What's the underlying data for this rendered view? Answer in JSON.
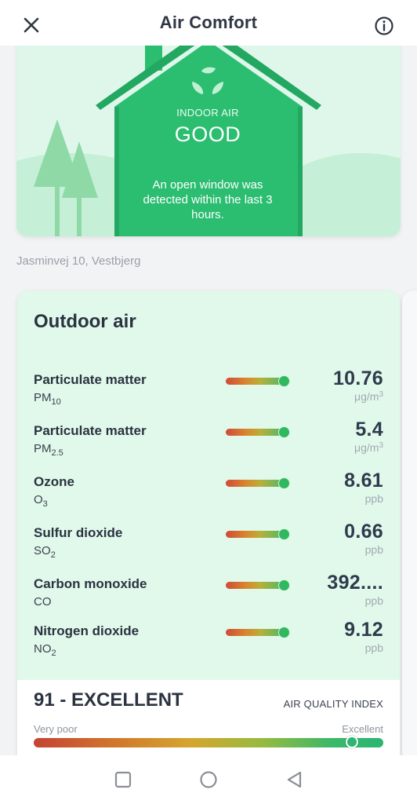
{
  "header": {
    "title": "Air Comfort"
  },
  "icons": {
    "close": "close-icon",
    "info": "info-icon",
    "leaves": "leaves-icon",
    "nav_recents": "square-icon",
    "nav_home": "circle-icon",
    "nav_back": "triangle-back-icon"
  },
  "indoor": {
    "label": "INDOOR AIR",
    "status": "GOOD",
    "message": "An open window was detected within the last 3 hours."
  },
  "address": "Jasminvej 10, Vestbjerg",
  "outdoor": {
    "title": "Outdoor air",
    "pollutants": [
      {
        "name": "Particulate matter",
        "formula": "PM",
        "formula_sub": "10",
        "value": "10.76",
        "unit": "μg/m",
        "unit_sup": "3"
      },
      {
        "name": "Particulate matter",
        "formula": "PM",
        "formula_sub": "2.5",
        "value": "5.4",
        "unit": "μg/m",
        "unit_sup": "3"
      },
      {
        "name": "Ozone",
        "formula": "O",
        "formula_sub": "3",
        "value": "8.61",
        "unit": "ppb",
        "unit_sup": ""
      },
      {
        "name": "Sulfur dioxide",
        "formula": "SO",
        "formula_sub": "2",
        "value": "0.66",
        "unit": "ppb",
        "unit_sup": ""
      },
      {
        "name": "Carbon monoxide",
        "formula": "CO",
        "formula_sub": "",
        "value": "392....",
        "unit": "ppb",
        "unit_sup": ""
      },
      {
        "name": "Nitrogen dioxide",
        "formula": "NO",
        "formula_sub": "2",
        "value": "9.12",
        "unit": "ppb",
        "unit_sup": ""
      }
    ]
  },
  "aqi": {
    "score_text": "91 - EXCELLENT",
    "label": "AIR QUALITY INDEX",
    "min_label": "Very poor",
    "max_label": "Excellent",
    "level": 0.91
  },
  "colors": {
    "accent_green": "#2ab673",
    "house_green": "#2bbd70",
    "text_dark": "#2b3240"
  }
}
